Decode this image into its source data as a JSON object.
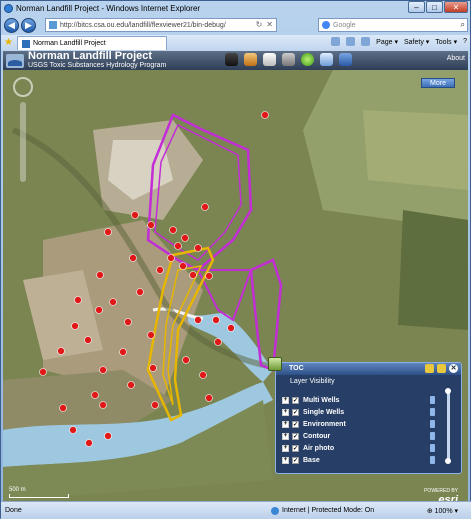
{
  "browser": {
    "title": "Norman Landfill Project - Windows Internet Explorer",
    "url": "http://bitcs.csa.ou.edu/landfill/flexviewer21/bin-debug/",
    "search_placeholder": "Google",
    "tab_label": "Norman Landfill Project",
    "commands": [
      "Page ▾",
      "Safety ▾",
      "Tools ▾",
      "?"
    ]
  },
  "app": {
    "title": "Norman Landfill Project",
    "subtitle": "USGS Toxic Substances Hydrology Program",
    "about_label": "About",
    "more_label": "More",
    "tool_icons": [
      "map-icon",
      "layers-icon",
      "print-icon",
      "search-icon",
      "globe-icon",
      "edit-icon",
      "draw-icon"
    ]
  },
  "toc": {
    "title": "TOC",
    "subtitle": "Layer Visibility",
    "layers": [
      {
        "label": "Multi Wells",
        "checked": true
      },
      {
        "label": "Single Wells",
        "checked": true
      },
      {
        "label": "Environment",
        "checked": true
      },
      {
        "label": "Contour",
        "checked": true
      },
      {
        "label": "Air photo",
        "checked": true
      },
      {
        "label": "Base",
        "checked": true
      }
    ]
  },
  "map": {
    "scale_label": "500 m",
    "powered_by": "POWERED BY",
    "esri_label": "esri"
  },
  "status": {
    "left": "Done",
    "zone": "Internet | Protected Mode: On",
    "zoom": "⊕ 100% ▾"
  },
  "colors": {
    "boundary": "#c32dd6",
    "plume": "#e6b600",
    "well": "#e01818",
    "water": "#9ec8e0"
  }
}
